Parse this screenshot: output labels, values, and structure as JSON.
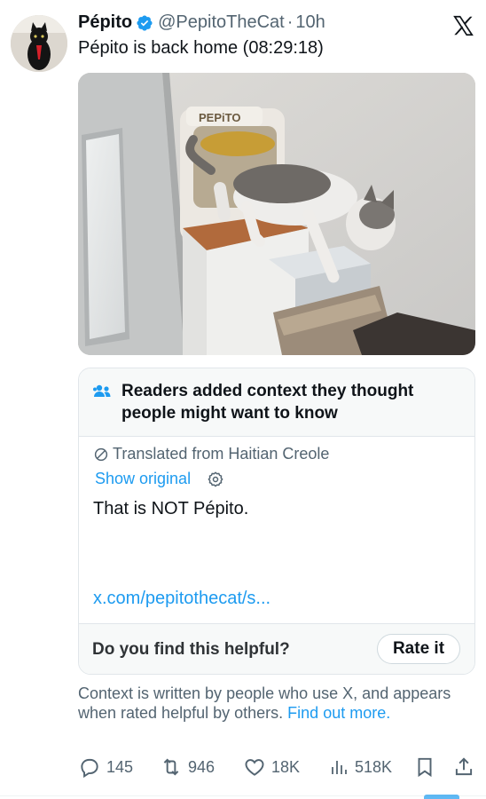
{
  "tweet": {
    "display_name": "Pépito",
    "handle": "@PepitoTheCat",
    "separator": "·",
    "time": "10h",
    "text": "Pépito is back home (08:29:18)"
  },
  "image_sign": "PEPiTO",
  "community_note": {
    "title": "Readers added context they thought people might want to know",
    "translated_label": "Translated from Haitian Creole",
    "show_original": "Show original",
    "body": "That is NOT Pépito.",
    "link": "x.com/pepitothecat/s...",
    "helpful_question": "Do you find this helpful?",
    "rate_button": "Rate it"
  },
  "context_footer": {
    "text": "Context is written by people who use X, and appears when rated helpful by others.",
    "link": "Find out more."
  },
  "actions": {
    "replies": "145",
    "reposts": "946",
    "likes": "18K",
    "views": "518K"
  },
  "colors": {
    "accent": "#1d9bf0",
    "secondary_text": "#536471",
    "note_background": "#f7f9f9"
  },
  "icons": [
    "verified-badge-icon",
    "x-logo-icon",
    "people-icon",
    "translate-icon",
    "gear-icon",
    "reply-icon",
    "repost-icon",
    "like-icon",
    "views-icon",
    "bookmark-icon",
    "share-icon"
  ]
}
